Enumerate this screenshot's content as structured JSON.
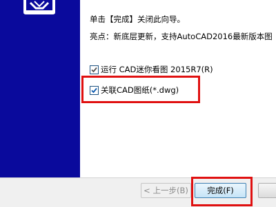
{
  "wizard": {
    "line1": "单击【完成】关闭此向导。",
    "line2": "亮点：新底层更新，支持AutoCAD2016最新版本图",
    "options": [
      {
        "label": "运行 CAD迷你看图 2015R7(R)",
        "checked": true
      },
      {
        "label": "关联CAD图纸(*.dwg)",
        "checked": true
      }
    ]
  },
  "buttons": {
    "back": "< 上一步(B)",
    "finish": "完成(F)",
    "cancel": ""
  },
  "colors": {
    "sidebar": "#0a0a9c",
    "highlight": "#e01010"
  },
  "icons": {
    "logo": "cad-logo-icon"
  }
}
